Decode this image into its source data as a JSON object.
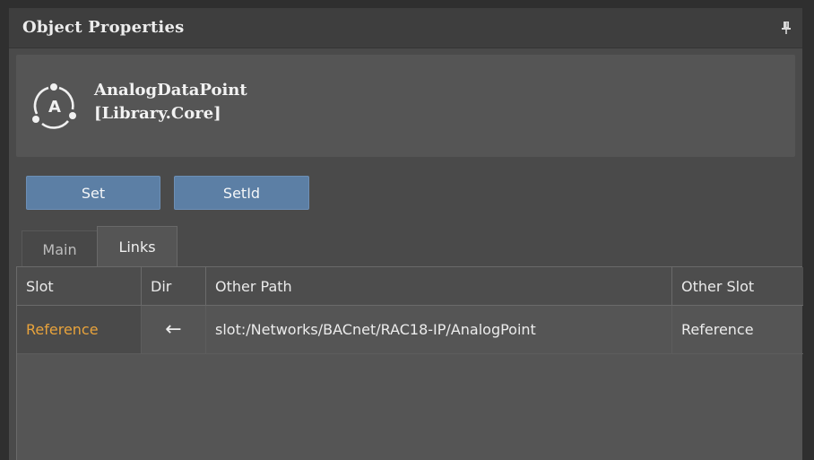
{
  "panel": {
    "title": "Object Properties",
    "pin_icon": "pin-icon"
  },
  "object": {
    "icon": "analog-datapoint-icon",
    "icon_letter": "A",
    "name": "AnalogDataPoint",
    "library": "[Library.Core]"
  },
  "buttons": {
    "set": "Set",
    "setid": "SetId"
  },
  "tabs": [
    {
      "label": "Main",
      "active": false
    },
    {
      "label": "Links",
      "active": true
    }
  ],
  "grid": {
    "columns": [
      "Slot",
      "Dir",
      "Other Path",
      "Other Slot"
    ],
    "rows": [
      {
        "slot": "Reference",
        "dir": "←",
        "other_path": "slot:/Networks/BACnet/RAC18-IP/AnalogPoint",
        "other_slot": "Reference"
      }
    ]
  },
  "colors": {
    "accent_button": "#5c7fa5",
    "slot_highlight": "#e8a33c",
    "panel_bg": "#4a4a4a"
  }
}
